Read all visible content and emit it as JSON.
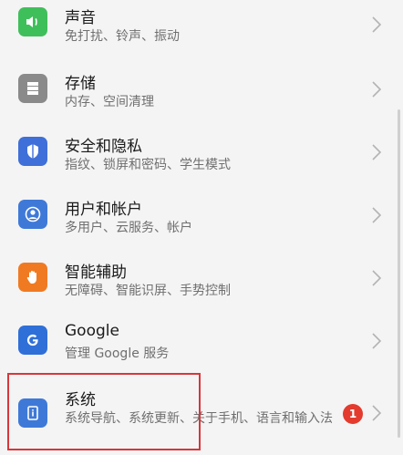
{
  "items": [
    {
      "title": "声音",
      "subtitle": "免打扰、铃声、振动",
      "icon": "speaker-icon",
      "color": "#3fbf5a"
    },
    {
      "title": "存储",
      "subtitle": "内存、空间清理",
      "icon": "storage-icon",
      "color": "#8a8a8a"
    },
    {
      "title": "安全和隐私",
      "subtitle": "指纹、锁屏和密码、学生模式",
      "icon": "shield-icon",
      "color": "#3f6fd8"
    },
    {
      "title": "用户和帐户",
      "subtitle": "多用户、云服务、帐户",
      "icon": "user-icon",
      "color": "#3f79d8"
    },
    {
      "title": "智能辅助",
      "subtitle": "无障碍、智能识屏、手势控制",
      "icon": "hand-icon",
      "color": "#f07a22"
    },
    {
      "title": "Google",
      "subtitle": "管理 Google 服务",
      "icon": "google-icon",
      "color": "#2f6fd8"
    },
    {
      "title": "系统",
      "subtitle": "系统导航、系统更新、关于手机、语言和输入法",
      "icon": "info-icon",
      "color": "#3f79d8"
    }
  ],
  "badge": "1"
}
